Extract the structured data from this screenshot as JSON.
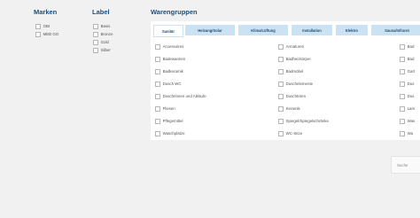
{
  "marken": {
    "title": "Marken",
    "options": [
      "OBI",
      "MEB GO"
    ]
  },
  "label": {
    "title": "Label",
    "options": [
      "Basis",
      "Bronze",
      "Gold",
      "Silber"
    ]
  },
  "warengruppen": {
    "title": "Warengruppen",
    "tabs": [
      "Sanitär",
      "Heizung/Solar",
      "Klima/Lüftung",
      "Installation",
      "Elektro",
      "Sauna/Infrarot"
    ],
    "columns": [
      [
        "Accessoires",
        "Badewannen",
        "Badkeramik",
        "Dusch WC",
        "Duschrinnen und Abläufe",
        "Fliesen",
        "Pflegemittel",
        "Waschplätze"
      ],
      [
        "Armaturen",
        "Badheizkörper",
        "Badmöbel",
        "Duschelemente",
        "Duschtüren",
        "Keramik",
        "Spiegel/Spiegelschränke",
        "WC-Sitze"
      ],
      [
        "Bad",
        "Bad",
        "Gart",
        "Dus",
        "Dus",
        "Lam",
        "Was",
        "Wa"
      ]
    ]
  },
  "button": {
    "label": "Suche"
  }
}
